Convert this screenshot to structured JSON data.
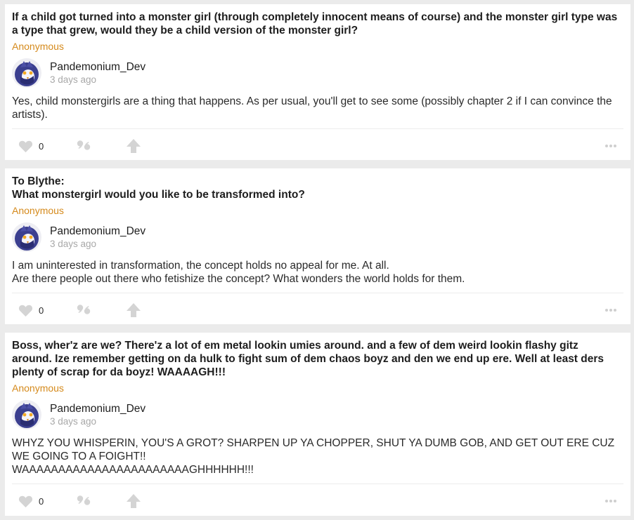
{
  "posts": [
    {
      "question": "If a child got turned into a monster girl (through completely innocent means of course) and the monster girl type was a type that grew, would they be a child version of the monster girl?",
      "asker": "Anonymous",
      "author": "Pandemonium_Dev",
      "time": "3 days ago",
      "answer": "Yes, child monstergirls are a thing that happens. As per usual, you'll get to see some (possibly chapter 2 if I can convince the artists).",
      "likes": "0"
    },
    {
      "question": "To Blythe:\nWhat monstergirl would you like to be transformed into?",
      "asker": "Anonymous",
      "author": "Pandemonium_Dev",
      "time": "3 days ago",
      "answer": "I am uninterested in transformation, the concept holds no appeal for me. At all.\nAre there people out there who fetishize the concept? What wonders the world holds for them.",
      "likes": "0"
    },
    {
      "question": "Boss, wher'z are we? There'z a lot of em metal lookin umies around. and a few of dem weird lookin flashy gitz around. Ize remember getting on da hulk to fight sum of dem chaos boyz and den we end up ere. Well at least ders plenty of scrap for da boyz! WAAAAGH!!!",
      "asker": "Anonymous",
      "author": "Pandemonium_Dev",
      "time": "3 days ago",
      "answer": "WHYZ YOU WHISPERIN, YOU'S A GROT? SHARPEN UP YA CHOPPER, SHUT YA DUMB GOB, AND GET OUT ERE CUZ WE GOING TO A FOIGHT!!\nWAAAAAAAAAAAAAAAAAAAAAAAGHHHHHH!!!",
      "likes": "0"
    }
  ],
  "icons": {
    "like": "heart-icon",
    "quote": "quote-icon",
    "share": "up-arrow-icon",
    "more": "more-dots-icon"
  },
  "colors": {
    "asker": "#d58a1c",
    "timestamp": "#a8a8a8",
    "icon": "#d4d4d4",
    "background": "#ebebeb"
  }
}
